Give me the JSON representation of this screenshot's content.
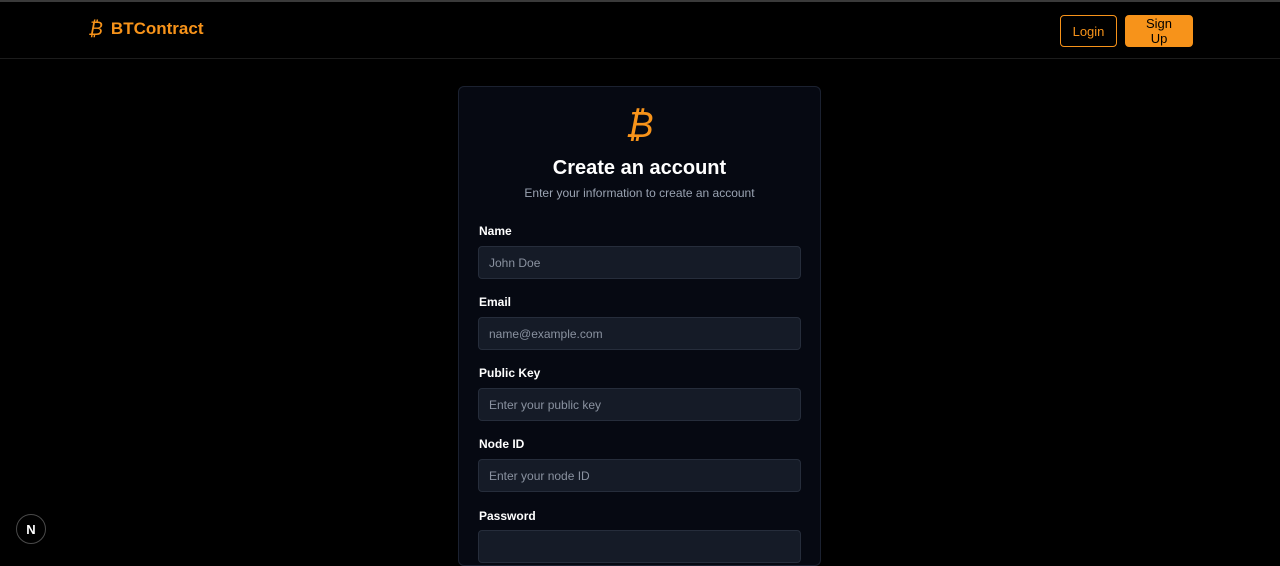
{
  "brand": {
    "icon": "bitcoin-icon",
    "icon_glyph": "₿",
    "name": "BTContract",
    "accent": "#f7931a"
  },
  "nav": {
    "login_label": "Login",
    "signup_label": "Sign Up"
  },
  "form": {
    "logo_glyph": "₿",
    "title": "Create an account",
    "subtitle": "Enter your information to create an account",
    "fields": [
      {
        "label": "Name",
        "placeholder": "John Doe",
        "value": ""
      },
      {
        "label": "Email",
        "placeholder": "name@example.com",
        "value": ""
      },
      {
        "label": "Public Key",
        "placeholder": "Enter your public key",
        "value": ""
      },
      {
        "label": "Node ID",
        "placeholder": "Enter your node ID",
        "value": ""
      },
      {
        "label": "Password",
        "placeholder": "",
        "value": ""
      }
    ]
  },
  "dev_badge": {
    "icon": "nextjs-icon",
    "glyph": "N"
  }
}
